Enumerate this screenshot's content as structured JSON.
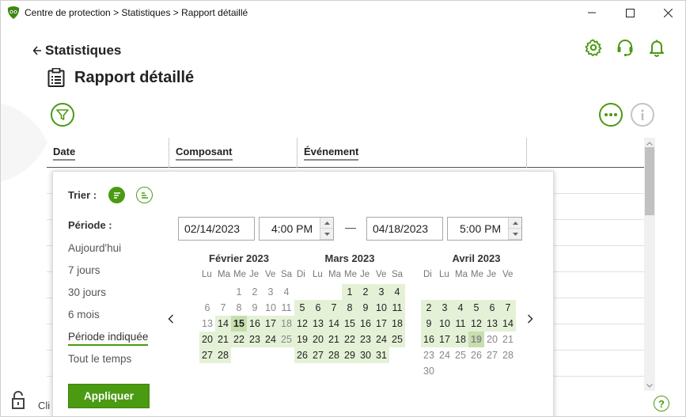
{
  "window": {
    "title": "Centre de protection > Statistiques > Rapport détaillé"
  },
  "header": {
    "back_label": "Statistiques",
    "page_title": "Rapport détaillé"
  },
  "table": {
    "columns": [
      "Date",
      "Composant",
      "Événement"
    ]
  },
  "status": {
    "text": "Cli"
  },
  "popup": {
    "sort_label": "Trier :",
    "period_label": "Période :",
    "periods": [
      "Aujourd'hui",
      "7 jours",
      "30 jours",
      "6 mois",
      "Période indiquée",
      "Tout le temps"
    ],
    "active_period": "Période indiquée",
    "apply_label": "Appliquer",
    "start_date": "02/14/2023",
    "start_time": "4:00 PM",
    "end_date": "04/18/2023",
    "end_time": "5:00 PM",
    "range_separator": "—"
  },
  "calendars": [
    {
      "title": "Février 2023",
      "weekdays": [
        "Lu",
        "Ma",
        "Me",
        "Je",
        "Ve",
        "Sa"
      ],
      "first_col": 1,
      "weeks": [
        [
          "",
          "",
          "",
          "1",
          "2",
          "3",
          "4"
        ],
        [
          "",
          "6",
          "7",
          "8",
          "9",
          "10",
          "11"
        ],
        [
          "",
          "13",
          "14",
          "15",
          "16",
          "17",
          "18"
        ],
        [
          "",
          "20",
          "21",
          "22",
          "23",
          "24",
          "25"
        ],
        [
          "",
          "27",
          "28",
          "",
          "",
          "",
          ""
        ]
      ]
    },
    {
      "title": "Mars 2023",
      "weekdays": [
        "Di",
        "Lu",
        "Ma",
        "Me",
        "Je",
        "Ve",
        "Sa"
      ],
      "first_col": 0,
      "weeks": [
        [
          "",
          "",
          "",
          "1",
          "2",
          "3",
          "4"
        ],
        [
          "5",
          "6",
          "7",
          "8",
          "9",
          "10",
          "11"
        ],
        [
          "12",
          "13",
          "14",
          "15",
          "16",
          "17",
          "18"
        ],
        [
          "19",
          "20",
          "21",
          "22",
          "23",
          "24",
          "25"
        ],
        [
          "26",
          "27",
          "28",
          "29",
          "30",
          "31",
          ""
        ]
      ]
    },
    {
      "title": "Avril 2023",
      "weekdays": [
        "Di",
        "Lu",
        "Ma",
        "Me",
        "Je",
        "Ve"
      ],
      "first_col": 0,
      "weeks": [
        [
          "",
          "",
          "",
          "",
          "",
          "",
          ""
        ],
        [
          "2",
          "3",
          "4",
          "5",
          "6",
          "7",
          ""
        ],
        [
          "9",
          "10",
          "11",
          "12",
          "13",
          "14",
          ""
        ],
        [
          "16",
          "17",
          "18",
          "19",
          "20",
          "21",
          ""
        ],
        [
          "23",
          "24",
          "25",
          "26",
          "27",
          "28",
          ""
        ],
        [
          "30",
          "",
          "",
          "",
          "",
          "",
          ""
        ]
      ]
    }
  ],
  "colors": {
    "accent": "#4a9a12",
    "range_highlight": "#e4f1d7",
    "range_endpoint": "#c6dfae"
  }
}
